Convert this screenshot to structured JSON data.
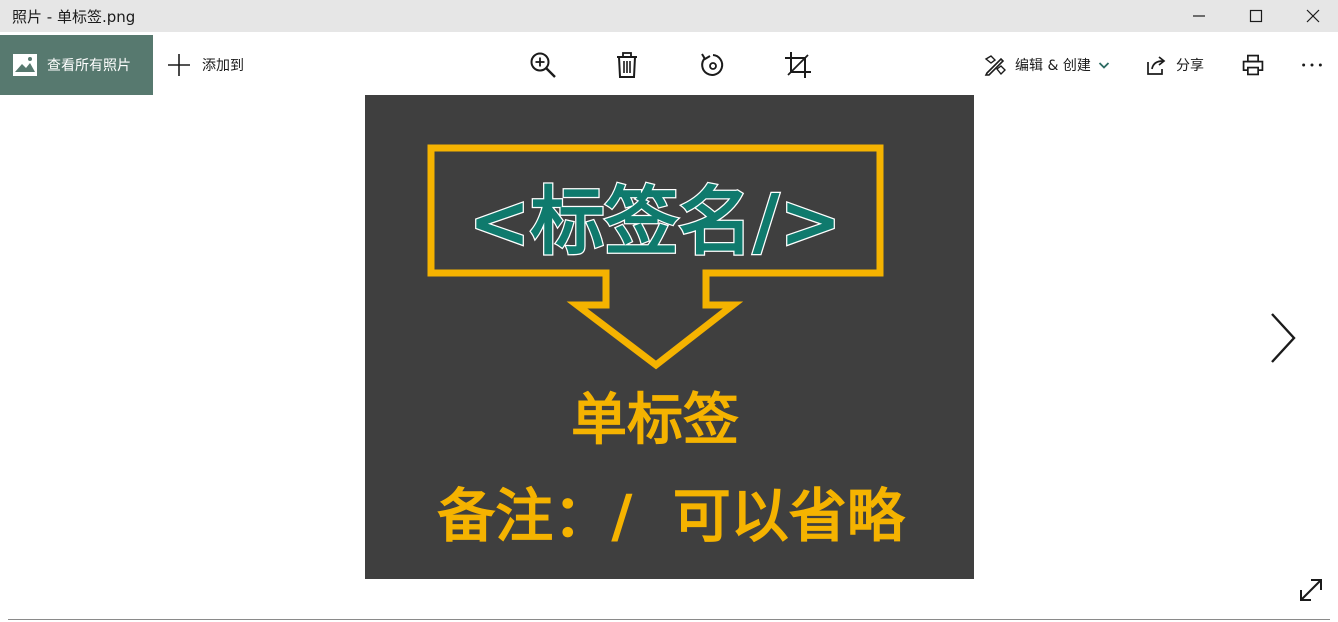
{
  "window": {
    "title": "照片 - 单标签.png"
  },
  "toolbar": {
    "view_all_label": "查看所有照片",
    "add_to_label": "添加到",
    "edit_create_label": "编辑 & 创建",
    "share_label": "分享"
  },
  "image": {
    "heading": "<标签名/>",
    "subheading": "单标签",
    "note": "备注：/  可以省略"
  },
  "colors": {
    "accent_sidebar": "#57796f",
    "photo_bg": "#3f3f3f",
    "callout_yellow": "#f5b300",
    "tag_teal": "#0f7a6d"
  },
  "icons": [
    "pictures-icon",
    "plus-icon",
    "zoom-in-icon",
    "delete-icon",
    "rotate-icon",
    "crop-icon",
    "edit-create-icon",
    "chevron-down-icon",
    "share-icon",
    "print-icon",
    "more-icon",
    "next-arrow-icon",
    "fullscreen-icon",
    "minimize-icon",
    "maximize-icon",
    "close-icon"
  ]
}
